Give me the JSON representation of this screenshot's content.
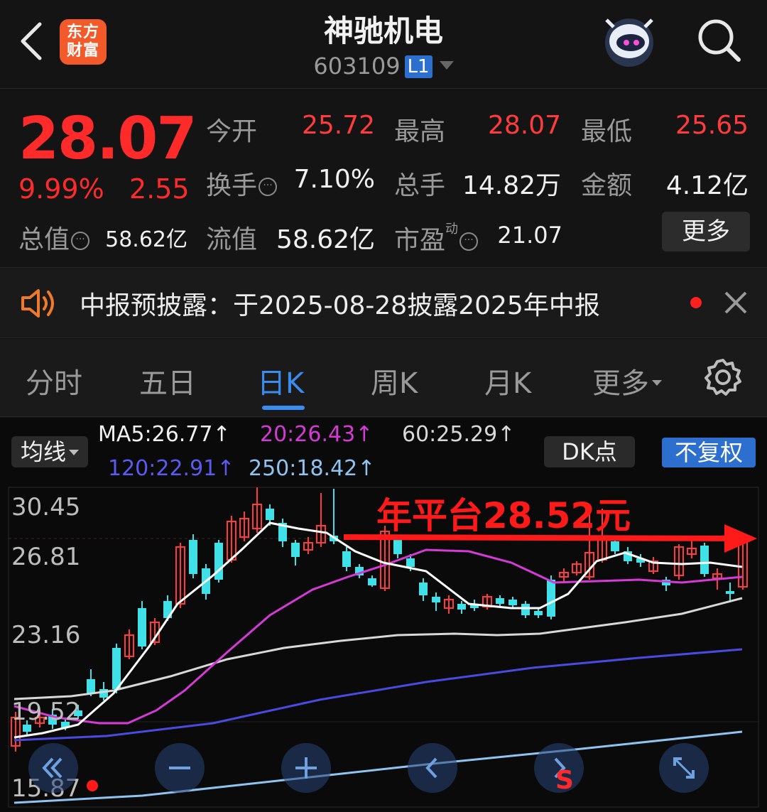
{
  "header": {
    "logo_text": "东方\n财富",
    "title": "神驰机电",
    "code": "603109",
    "level_badge": "L1",
    "icons": [
      "back-arrow-icon",
      "mascot-icon",
      "search-icon"
    ]
  },
  "quote": {
    "price": "28.07",
    "change_pct": "9.99%",
    "change_amt": "2.55",
    "open_label": "今开",
    "open": "25.72",
    "high_label": "最高",
    "high": "28.07",
    "low_label": "最低",
    "low": "25.65",
    "turnover_label": "换手",
    "turnover": "7.10%",
    "volume_label": "总手",
    "volume": "14.82万",
    "amount_label": "金额",
    "amount": "4.12亿",
    "mktcap_label": "总值",
    "mktcap": "58.62亿",
    "float_label": "流值",
    "float_cap": "58.62亿",
    "pe_label": "市盈",
    "pe_sup": "动",
    "pe": "21.07",
    "more_label": "更多"
  },
  "notice": {
    "text": "中报预披露：于2025-08-28披露2025年中报"
  },
  "tabs": [
    {
      "label": "分时"
    },
    {
      "label": "五日"
    },
    {
      "label": "日K"
    },
    {
      "label": "周K"
    },
    {
      "label": "月K"
    },
    {
      "label": "更多"
    }
  ],
  "chart_toolbar": {
    "ma_selector": "均线",
    "ma5": "MA5:26.77↑",
    "ma20": "20:26.43↑",
    "ma60": "60:25.29↑",
    "ma120": "120:22.91↑",
    "ma250": "250:18.42↑",
    "dk_label": "DK点",
    "adjust_label": "不复权"
  },
  "chart_data": {
    "type": "candlestick",
    "y_ticks": [
      "30.45",
      "26.81",
      "23.16",
      "19.52",
      "15.87"
    ],
    "ylim": [
      15.87,
      30.45
    ],
    "annotation": "年平台28.52元",
    "reference_line": 28.52,
    "colors": {
      "up": "#ff3b3b",
      "down": "#3fe0e8",
      "ma5": "#ffffff",
      "ma20": "#d63ad6",
      "ma60": "#d8d8d8",
      "ma120": "#4a4ae0",
      "ma250": "#8fc4f2"
    }
  },
  "colors": {
    "accent": "#3a8df0",
    "up": "#ff2a2a",
    "brand": "#f25a29"
  }
}
